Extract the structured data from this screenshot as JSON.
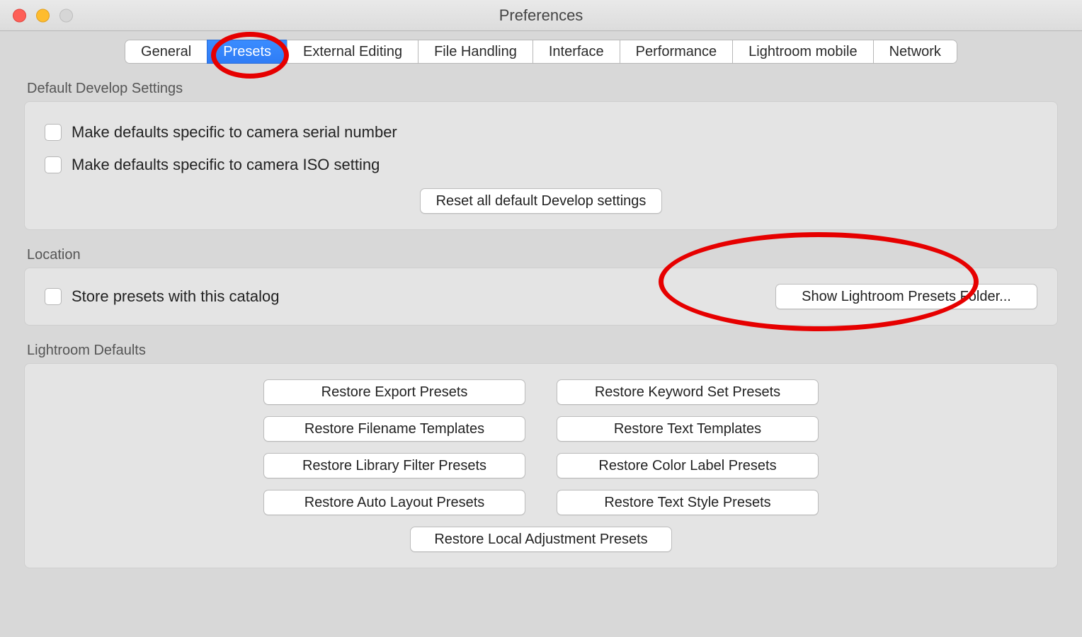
{
  "window": {
    "title": "Preferences"
  },
  "tabs": [
    {
      "label": "General",
      "active": false
    },
    {
      "label": "Presets",
      "active": true
    },
    {
      "label": "External Editing",
      "active": false
    },
    {
      "label": "File Handling",
      "active": false
    },
    {
      "label": "Interface",
      "active": false
    },
    {
      "label": "Performance",
      "active": false
    },
    {
      "label": "Lightroom mobile",
      "active": false
    },
    {
      "label": "Network",
      "active": false
    }
  ],
  "sections": {
    "develop": {
      "title": "Default Develop Settings",
      "check_serial": "Make defaults specific to camera serial number",
      "check_iso": "Make defaults specific to camera ISO setting",
      "reset_button": "Reset all default Develop settings"
    },
    "location": {
      "title": "Location",
      "check_store": "Store presets with this catalog",
      "show_button": "Show Lightroom Presets Folder..."
    },
    "defaults": {
      "title": "Lightroom Defaults",
      "buttons": {
        "export": "Restore Export Presets",
        "keyword": "Restore Keyword Set Presets",
        "filename": "Restore Filename Templates",
        "text_tpl": "Restore Text Templates",
        "library": "Restore Library Filter Presets",
        "color": "Restore Color Label Presets",
        "autolayout": "Restore Auto Layout Presets",
        "textstyle": "Restore Text Style Presets",
        "local": "Restore Local Adjustment Presets"
      }
    }
  }
}
